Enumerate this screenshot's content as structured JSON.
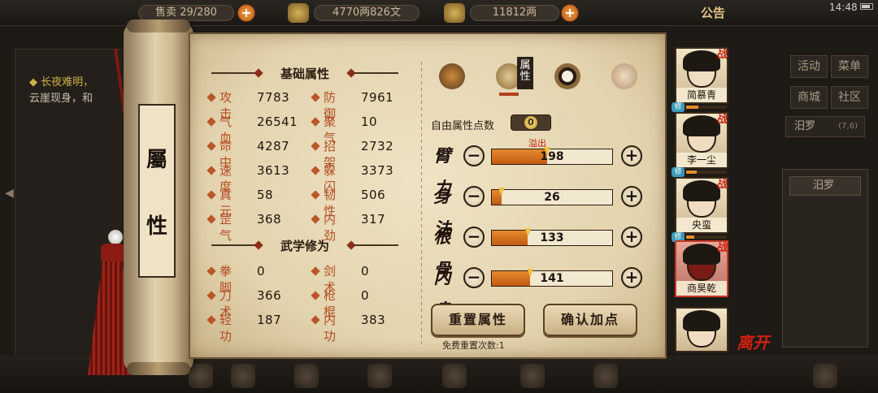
{
  "topbar": {
    "capacity_label": "售卖",
    "capacity": "29/280",
    "money": "4770两826文",
    "gold": "11812两",
    "notice": "公告",
    "time": "14:48"
  },
  "background": {
    "left_line1": "长夜难明，",
    "left_line2": "云崖现身，和",
    "right_menu": [
      "活动",
      "菜单",
      "商城",
      "社区"
    ],
    "location": "汨罗",
    "coord": "(7,6)",
    "location_item": "汨罗"
  },
  "scroll": {
    "title_top": "屬",
    "title_bottom": "性"
  },
  "basic": {
    "heading": "基础属性",
    "stats": [
      {
        "label": "攻击",
        "value": "7783"
      },
      {
        "label": "防御",
        "value": "7961"
      },
      {
        "label": "气血",
        "value": "26541"
      },
      {
        "label": "聚气",
        "value": "10"
      },
      {
        "label": "命中",
        "value": "4287"
      },
      {
        "label": "招架",
        "value": "2732"
      },
      {
        "label": "速度",
        "value": "3613"
      },
      {
        "label": "躲闪",
        "value": "3373"
      },
      {
        "label": "真元",
        "value": "58"
      },
      {
        "label": "韧性",
        "value": "506"
      },
      {
        "label": "罡气",
        "value": "368"
      },
      {
        "label": "内劲",
        "value": "317"
      }
    ]
  },
  "martial": {
    "heading": "武学修为",
    "stats": [
      {
        "label": "拳脚",
        "value": "0"
      },
      {
        "label": "剑术",
        "value": "0"
      },
      {
        "label": "刀术",
        "value": "366"
      },
      {
        "label": "枪棍",
        "value": "0"
      },
      {
        "label": "轻功",
        "value": "187"
      },
      {
        "label": "内功",
        "value": "383"
      }
    ]
  },
  "tabs": {
    "active_label": "属性",
    "icons": [
      "hat-icon",
      "attribute-book-icon",
      "bagua-icon",
      "meridian-body-icon"
    ]
  },
  "allocation": {
    "free_label": "自由属性点数",
    "free_value": "0",
    "overflow_label": "溢出",
    "attrs": [
      {
        "name": "臂力",
        "value": "198",
        "fill": 0.46
      },
      {
        "name": "身法",
        "value": "26",
        "fill": 0.08
      },
      {
        "name": "根骨",
        "value": "133",
        "fill": 0.3
      },
      {
        "name": "内息",
        "value": "141",
        "fill": 0.32
      }
    ],
    "minus": "−",
    "plus": "+",
    "reset_label": "重置属性",
    "confirm_label": "确认加点",
    "free_reset_note": "免费重置次数:1"
  },
  "party": {
    "battle_mark": "战",
    "training_mark": "修",
    "members": [
      {
        "name": "简慕青",
        "in_battle": true,
        "training": true,
        "exp": 0.3
      },
      {
        "name": "李一尘",
        "in_battle": true,
        "training": true,
        "exp": 0.25
      },
      {
        "name": "央蛮",
        "in_battle": true,
        "training": true,
        "exp": 0.2
      },
      {
        "name": "商昊乾",
        "in_battle": true,
        "training": false,
        "exp": 0
      },
      {
        "name": "",
        "in_battle": false,
        "training": false,
        "exp": 0
      }
    ],
    "leave_label": "离开"
  },
  "colors": {
    "accent": "#b24e26",
    "bar_fill": "#e07a22",
    "selected_portrait": "#c83a28"
  }
}
